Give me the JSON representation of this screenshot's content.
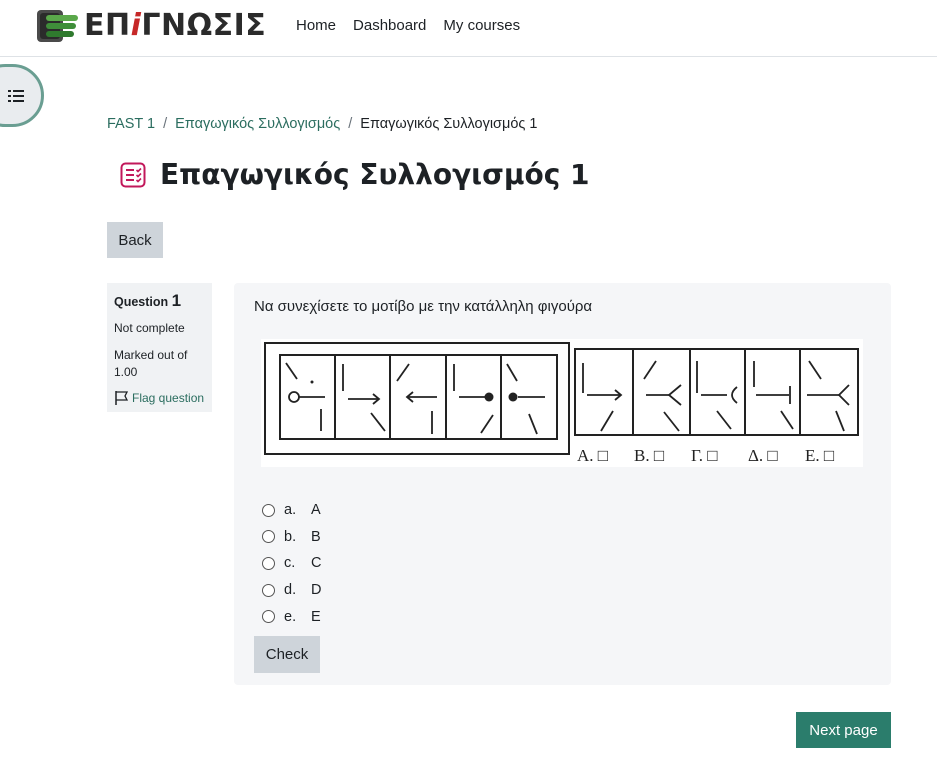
{
  "brand": {
    "text_main": "ΕΠ",
    "text_accent": "i",
    "text_rest": "ΓΝΩΣΙΣ"
  },
  "nav": {
    "items": [
      "Home",
      "Dashboard",
      "My courses"
    ]
  },
  "breadcrumb": {
    "items": [
      "FAST 1",
      "Επαγωγικός Συλλογισμός",
      "Επαγωγικός Συλλογισμός 1"
    ],
    "separator": "/"
  },
  "page": {
    "title": "Επαγωγικός Συλλογισμός 1"
  },
  "back_label": "Back",
  "question_info": {
    "label": "Question",
    "number": "1",
    "state": "Not complete",
    "grade": "Marked out of 1.00",
    "flag_label": "Flag question"
  },
  "question": {
    "text": "Να συνεχίσετε το μοτίβο με την κατάλληλη φιγούρα",
    "figure_labels": [
      "Α. □",
      "Β. □",
      "Γ. □",
      "Δ. □",
      "Ε. □"
    ],
    "answers": [
      {
        "letter": "a.",
        "text": "A"
      },
      {
        "letter": "b.",
        "text": "B"
      },
      {
        "letter": "c.",
        "text": "C"
      },
      {
        "letter": "d.",
        "text": "D"
      },
      {
        "letter": "e.",
        "text": "E"
      }
    ],
    "check_label": "Check"
  },
  "next_label": "Next page",
  "colors": {
    "accent": "#2b7d6c",
    "link": "#2b6d5f",
    "quiz_icon": "#c2185b",
    "secondary_btn": "#ced4da"
  },
  "icons": {
    "drawer": "list-icon",
    "quiz": "quiz-icon",
    "flag": "flag-icon"
  }
}
